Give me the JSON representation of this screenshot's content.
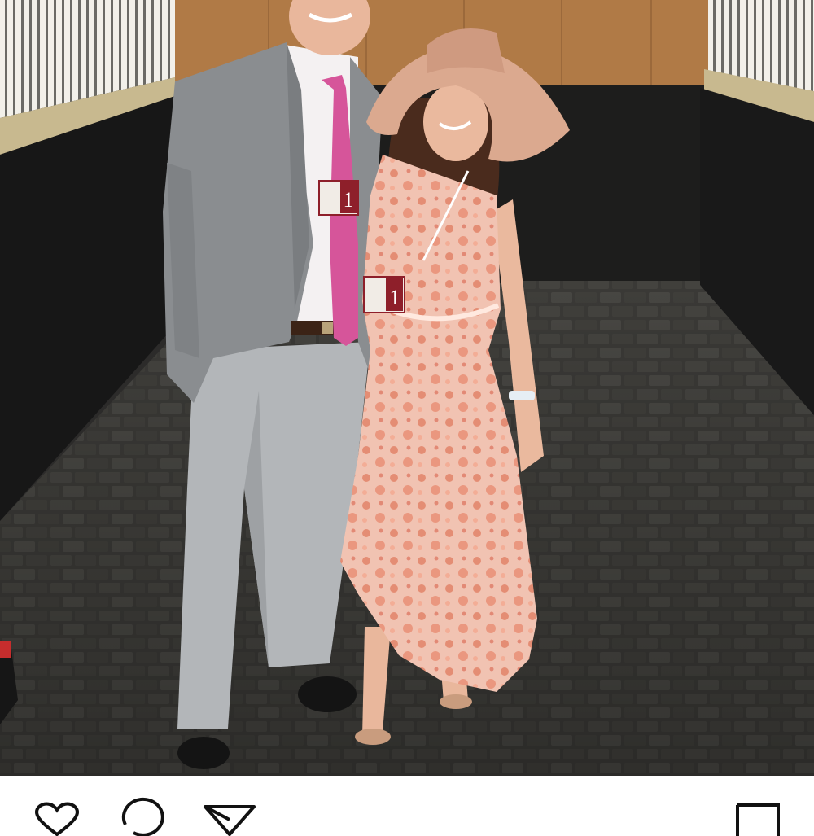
{
  "post": {
    "photo": {
      "subject": "couple-portrait-in-stable",
      "badges": [
        {
          "number": "1"
        },
        {
          "number": "1"
        }
      ]
    },
    "actions": {
      "like_icon": "heart-icon",
      "comment_icon": "comment-icon",
      "share_icon": "paper-plane-icon",
      "save_icon": "bookmark-icon"
    }
  },
  "colors": {
    "wall_wood": "#b07a46",
    "stall_dark": "#1b1b1b",
    "floor_pavers": "#3c3b38",
    "suit_jacket": "#8a8d90",
    "trousers": "#b3b6b9",
    "tie": "#d6559a",
    "dress": "#efb9a4",
    "hat": "#dba98f",
    "badge_red": "#8e1f2a"
  }
}
